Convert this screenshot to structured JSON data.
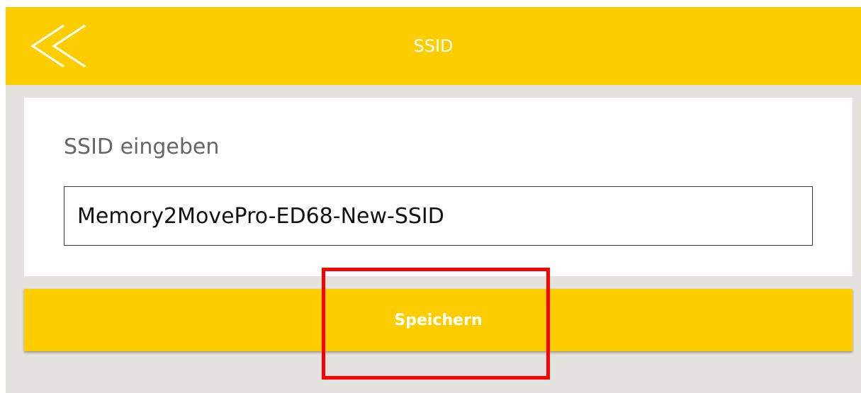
{
  "header": {
    "title": "SSID",
    "back_icon": "double-chevron-left-icon"
  },
  "form": {
    "label": "SSID eingeben",
    "ssid_value": "Memory2MovePro-ED68-New-SSID"
  },
  "actions": {
    "save_label": "Speichern"
  },
  "colors": {
    "accent": "#fecd00",
    "background": "#e4e2df",
    "highlight": "#ff0000"
  }
}
